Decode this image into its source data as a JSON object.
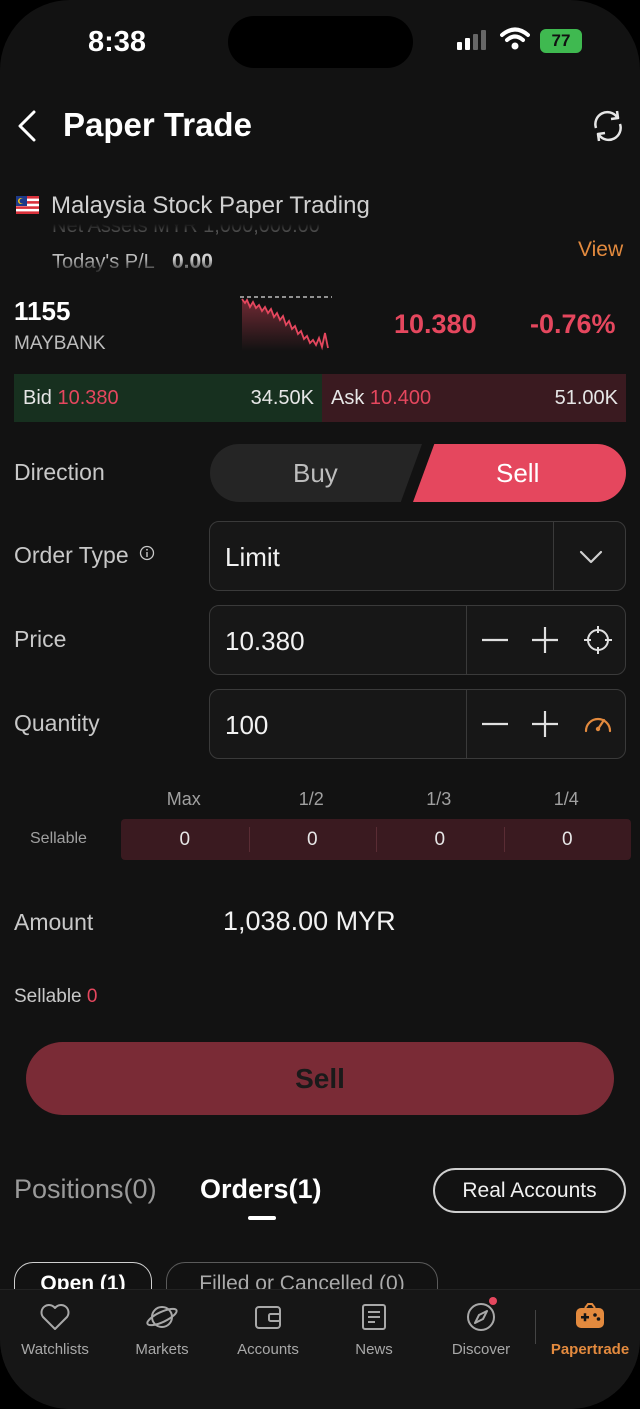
{
  "status_bar": {
    "time": "8:38",
    "battery": "77"
  },
  "header": {
    "title": "Paper Trade"
  },
  "account": {
    "name": "Malaysia Stock Paper Trading",
    "clipped_row": "Net Assets  MYR  1,000,000.00",
    "todays_pl_label": "Today's P/L",
    "todays_pl_value": "0.00",
    "view_label": "View"
  },
  "stock": {
    "code": "1155",
    "name": "MAYBANK",
    "price": "10.380",
    "change_pct": "-0.76%"
  },
  "bid_ask": {
    "bid_label": "Bid",
    "bid_price": "10.380",
    "bid_volume": "34.50K",
    "ask_label": "Ask",
    "ask_price": "10.400",
    "ask_volume": "51.00K"
  },
  "form": {
    "direction_label": "Direction",
    "buy_label": "Buy",
    "sell_label": "Sell",
    "order_type_label": "Order Type",
    "order_type_value": "Limit",
    "price_label": "Price",
    "price_value": "10.380",
    "quantity_label": "Quantity",
    "quantity_value": "100"
  },
  "portions": {
    "headers": [
      "Max",
      "1/2",
      "1/3",
      "1/4"
    ],
    "row_label": "Sellable",
    "values": [
      "0",
      "0",
      "0",
      "0"
    ]
  },
  "amount": {
    "label": "Amount",
    "value": "1,038.00 MYR"
  },
  "sellable": {
    "label": "Sellable",
    "value": "0"
  },
  "sell_button": "Sell",
  "tabs": {
    "positions": "Positions(0)",
    "orders": "Orders(1)",
    "real_accounts": "Real Accounts"
  },
  "order_filters": {
    "open": "Open (1)",
    "filled": "Filled or Cancelled (0)"
  },
  "tabbar": {
    "items": [
      {
        "label": "Watchlists",
        "icon": "heart-icon"
      },
      {
        "label": "Markets",
        "icon": "planet-icon"
      },
      {
        "label": "Accounts",
        "icon": "wallet-icon"
      },
      {
        "label": "News",
        "icon": "news-icon"
      },
      {
        "label": "Discover",
        "icon": "compass-icon"
      },
      {
        "label": "Papertrade",
        "icon": "gamepad-icon"
      }
    ]
  },
  "colors": {
    "red": "#e5475e",
    "orange": "#e38a3e",
    "green_bg": "#17301f",
    "red_bg": "#3a1a20"
  }
}
